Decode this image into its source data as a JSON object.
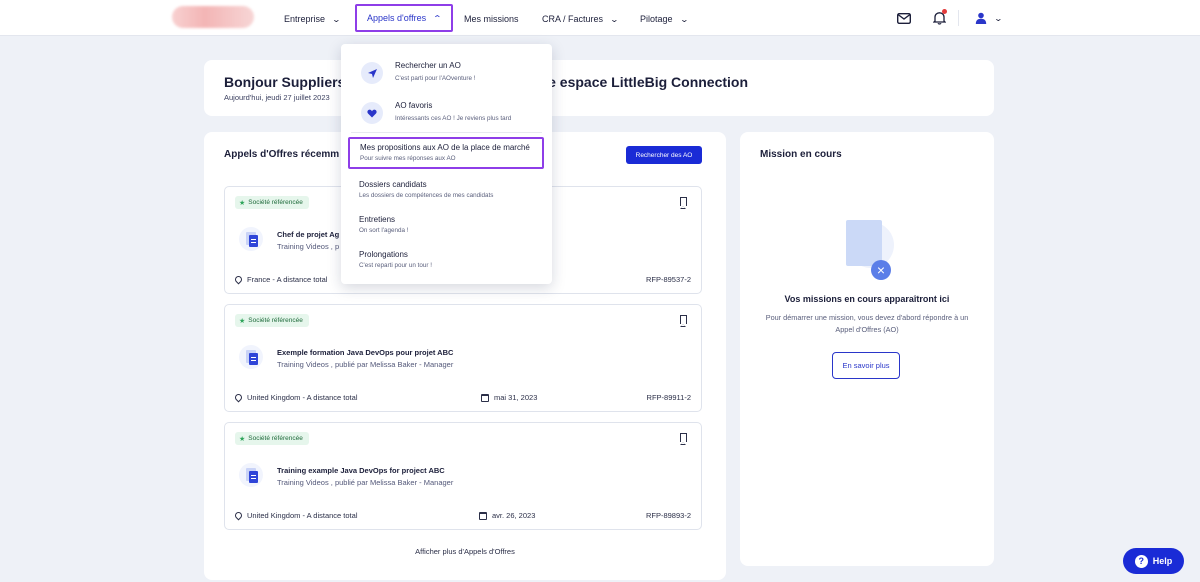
{
  "nav": {
    "items": [
      {
        "label": "Entreprise",
        "chevron": true
      },
      {
        "label": "Appels d'offres",
        "chevron": true,
        "active": true
      },
      {
        "label": "Mes missions",
        "chevron": false
      },
      {
        "label": "CRA / Factures",
        "chevron": true
      },
      {
        "label": "Pilotage",
        "chevron": true
      }
    ],
    "icons": [
      "mail-icon",
      "bell-icon",
      "user-icon",
      "chevron-down-icon"
    ]
  },
  "greeting": {
    "title": "Bonjour Suppliers",
    "title_tail": "tre espace LittleBig Connection",
    "date": "Aujourd'hui, jeudi 27 juillet 2023"
  },
  "offers_section": {
    "title": "Appels d'Offres récemm",
    "search_button": "Rechercher des AO",
    "more_link": "Afficher plus d'Appels d'Offres",
    "offers": [
      {
        "badge": "Société référencée",
        "title": "Chef de projet Ag",
        "subtitle": "Training Videos , p",
        "location": "France - A distance total",
        "date": "",
        "ref": "RFP-89537-2"
      },
      {
        "badge": "Société référencée",
        "title": "Exemple formation Java DevOps pour projet ABC",
        "subtitle": "Training Videos , publié par Melissa Baker - Manager",
        "location": "United Kingdom - A distance total",
        "date": "mai 31, 2023",
        "ref": "RFP-89911-2"
      },
      {
        "badge": "Société référencée",
        "title": "Training example Java DevOps for project ABC",
        "subtitle": "Training Videos , publié par Melissa Baker - Manager",
        "location": "United Kingdom - A distance total",
        "date": "avr. 26, 2023",
        "ref": "RFP-89893-2"
      }
    ]
  },
  "mission": {
    "title": "Mission en cours",
    "empty_title": "Vos missions en cours apparaîtront ici",
    "empty_text": "Pour démarrer une mission, vous devez d'abord répondre à un Appel d'Offres (AO)",
    "button": "En savoir plus"
  },
  "dropdown": {
    "items": [
      {
        "label": "Rechercher un AO",
        "sub": "C'est parti pour l'AOventure !",
        "icon": "send-icon"
      },
      {
        "label": "AO favoris",
        "sub": "Intéressants ces AO ! Je reviens plus tard",
        "icon": "heart-icon"
      },
      {
        "label": "Mes propositions aux AO de la place de marché",
        "sub": "Pour suivre mes réponses aux AO",
        "highlighted": true
      },
      {
        "label": "Dossiers candidats",
        "sub": "Les dossiers de compétences de mes candidats"
      },
      {
        "label": "Entretiens",
        "sub": "On sort l'agenda !"
      },
      {
        "label": "Prolongations",
        "sub": "C'est reparti pour un tour !"
      }
    ]
  },
  "help": {
    "label": "Help"
  },
  "colors": {
    "accent": "#1a2bd6",
    "highlight": "#8e3ee8",
    "badge_bg": "#e6f6ec",
    "page_bg": "#eef1f7"
  }
}
